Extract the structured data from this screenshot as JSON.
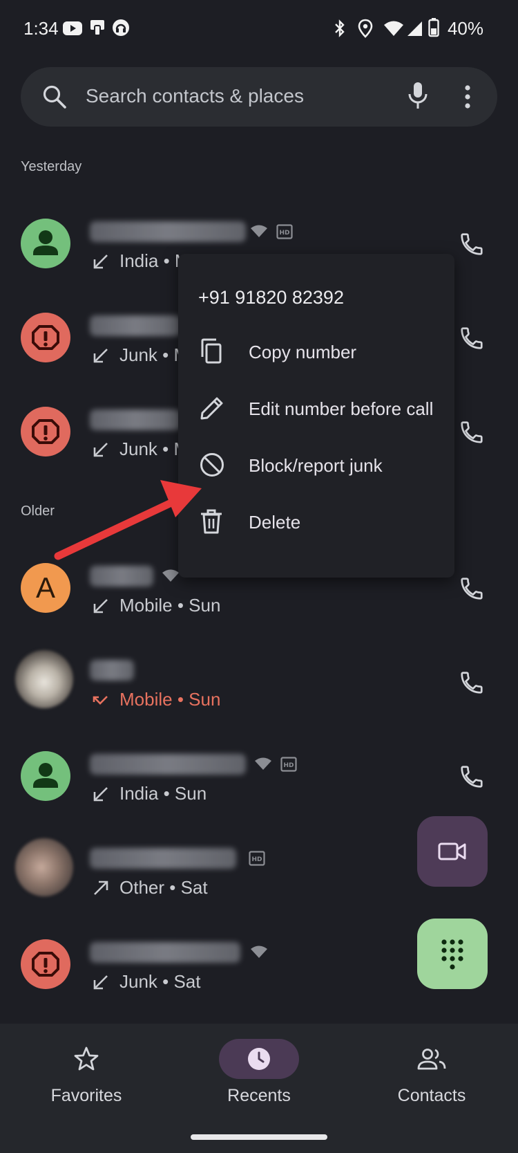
{
  "status_bar": {
    "time": "1:34",
    "battery": "40%"
  },
  "search": {
    "placeholder": "Search contacts & places"
  },
  "sections": {
    "yesterday": "Yesterday",
    "older": "Older"
  },
  "calls": [
    {
      "subtitle": "India • M",
      "type": "incoming",
      "avatar": "person"
    },
    {
      "subtitle": "Junk • M",
      "type": "incoming",
      "avatar": "spam"
    },
    {
      "subtitle": "Junk • M",
      "type": "incoming",
      "avatar": "spam"
    },
    {
      "subtitle": "Mobile • Sun",
      "type": "incoming",
      "avatar": "letter",
      "letter": "A"
    },
    {
      "subtitle": "Mobile • Sun",
      "type": "missed",
      "avatar": "photo"
    },
    {
      "subtitle": "India • Sun",
      "type": "incoming",
      "avatar": "person"
    },
    {
      "subtitle": "Other • Sat",
      "type": "outgoing",
      "avatar": "photo"
    },
    {
      "subtitle": "Junk • Sat",
      "type": "incoming",
      "avatar": "spam"
    }
  ],
  "menu": {
    "number": "+91 91820 82392",
    "items": [
      {
        "label": "Copy number",
        "icon": "copy-icon"
      },
      {
        "label": "Edit number before call",
        "icon": "pencil-icon"
      },
      {
        "label": "Block/report junk",
        "icon": "block-icon"
      },
      {
        "label": "Delete",
        "icon": "trash-icon"
      }
    ]
  },
  "nav": {
    "favorites": "Favorites",
    "recents": "Recents",
    "contacts": "Contacts"
  },
  "colors": {
    "background": "#1d1e24",
    "missed": "#e8725f",
    "accent_active": "#4b3a55",
    "dialpad_fab": "#9fd59c",
    "annotation_arrow": "#e8393a"
  }
}
